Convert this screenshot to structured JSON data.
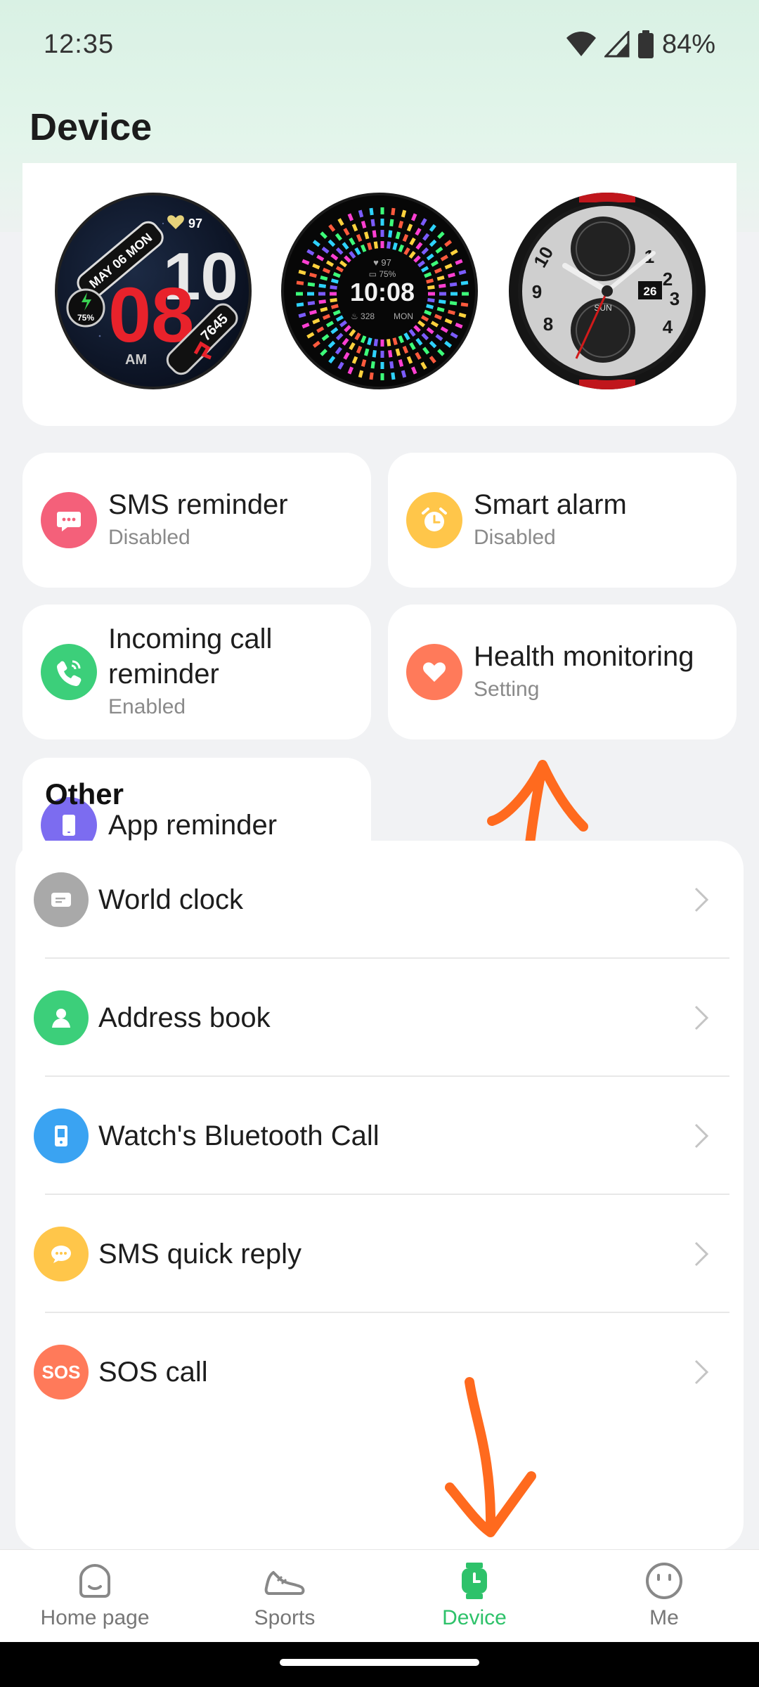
{
  "status_bar": {
    "time": "12:35",
    "battery": "84%"
  },
  "header": {
    "title": "Device"
  },
  "watch_faces": [
    {
      "name": "watch-face-digital-red",
      "date": "MAY 06 MON",
      "hour": "10",
      "minute": "08",
      "ampm": "AM",
      "heart": "97",
      "battery": "75%",
      "steps": "7645"
    },
    {
      "name": "watch-face-radial",
      "time": "10:08",
      "heart": "97",
      "battery": "75%",
      "calories": "328",
      "day": "MON"
    },
    {
      "name": "watch-face-analog",
      "date": "26",
      "day": "SUN"
    }
  ],
  "tiles": [
    {
      "title": "SMS reminder",
      "subtitle": "Disabled",
      "icon": "message-icon",
      "color": "#f4607a"
    },
    {
      "title": "Smart alarm",
      "subtitle": "Disabled",
      "icon": "alarm-clock-icon",
      "color": "#ffc64a"
    },
    {
      "title_line1": "Incoming call",
      "title_line2": "reminder",
      "subtitle": "Enabled",
      "icon": "phone-icon",
      "color": "#3ccf7a"
    },
    {
      "title": "Health monitoring",
      "subtitle": "Setting",
      "icon": "heart-icon",
      "color": "#ff7a5a"
    },
    {
      "title": "App reminder",
      "icon": "phone-device-icon",
      "color": "#7c6cf0"
    }
  ],
  "other": {
    "title": "Other",
    "items": [
      {
        "label": "World clock",
        "icon": "world-clock-icon",
        "color": "#a9a9a9"
      },
      {
        "label": "Address book",
        "icon": "person-icon",
        "color": "#3ccf7a"
      },
      {
        "label": "Watch's Bluetooth Call",
        "icon": "watch-call-icon",
        "color": "#3aa3f2"
      },
      {
        "label": "SMS quick reply",
        "icon": "chat-dots-icon",
        "color": "#ffc64a"
      },
      {
        "label": "SOS call",
        "icon": "sos-icon",
        "icon_text": "SOS",
        "color": "#ff7a5a"
      }
    ]
  },
  "bottom_nav": {
    "items": [
      {
        "label": "Home page",
        "icon": "home-face-icon"
      },
      {
        "label": "Sports",
        "icon": "shoe-icon"
      },
      {
        "label": "Device",
        "icon": "watch-icon",
        "active": true
      },
      {
        "label": "Me",
        "icon": "smiley-icon"
      }
    ]
  },
  "colors": {
    "accent": "#2ec26a",
    "annotation": "#ff6a1e"
  }
}
